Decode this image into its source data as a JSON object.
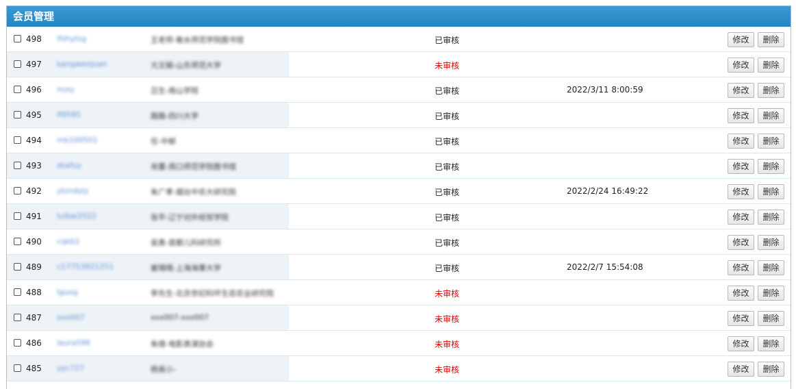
{
  "panel": {
    "title": "会员管理"
  },
  "actions": {
    "edit_label": "修改",
    "delete_label": "删除"
  },
  "rows": [
    {
      "id": "498",
      "username": "lfshytsg",
      "realname": "王老师-衡水师范学院图书馆",
      "status": "已审核",
      "status_type": "ok",
      "time": ""
    },
    {
      "id": "497",
      "username": "kangwenjuan",
      "realname": "亢文娟-山东师范大学",
      "status": "未审核",
      "status_type": "no",
      "time": ""
    },
    {
      "id": "496",
      "username": "nsxy",
      "realname": "吕生-南山学院",
      "status": "已审核",
      "status_type": "ok",
      "time": "2022/3/11 8:00:59"
    },
    {
      "id": "495",
      "username": "lf9595",
      "realname": "路路-四川大学",
      "status": "已审核",
      "status_type": "ok",
      "time": ""
    },
    {
      "id": "494",
      "username": "mb100501",
      "realname": "任-中邮",
      "status": "已审核",
      "status_type": "ok",
      "time": ""
    },
    {
      "id": "493",
      "username": "zkafuy",
      "realname": "肖蕾-周口师范学院图书馆",
      "status": "已审核",
      "status_type": "ok",
      "time": ""
    },
    {
      "id": "492",
      "username": "ytzndyjy",
      "realname": "朱广孝-烟台中农大研究院",
      "status": "已审核",
      "status_type": "ok",
      "time": "2022/2/24 16:49:22"
    },
    {
      "id": "491",
      "username": "luibai2022",
      "realname": "张平-辽宁对外经贸学院",
      "status": "已审核",
      "status_type": "ok",
      "time": ""
    },
    {
      "id": "490",
      "username": "cqkb2",
      "realname": "吴勇-首都儿科研究所",
      "status": "已审核",
      "status_type": "ok",
      "time": ""
    },
    {
      "id": "489",
      "username": "c17753921251",
      "realname": "崔晴晴-上海海事大学",
      "status": "已审核",
      "status_type": "ok",
      "time": "2022/2/7 15:54:08"
    },
    {
      "id": "488",
      "username": "lguog",
      "realname": "李先生-北京世纪科环生态农业研究院",
      "status": "未审核",
      "status_type": "no",
      "time": ""
    },
    {
      "id": "487",
      "username": "xxx007",
      "realname": "xxx007-xxx007",
      "status": "未审核",
      "status_type": "no",
      "time": ""
    },
    {
      "id": "486",
      "username": "laura596",
      "realname": "朱倩-电影表演协会",
      "status": "未审核",
      "status_type": "no",
      "time": ""
    },
    {
      "id": "485",
      "username": "yyc727",
      "realname": "杨易小-",
      "status": "未审核",
      "status_type": "no",
      "time": ""
    }
  ]
}
